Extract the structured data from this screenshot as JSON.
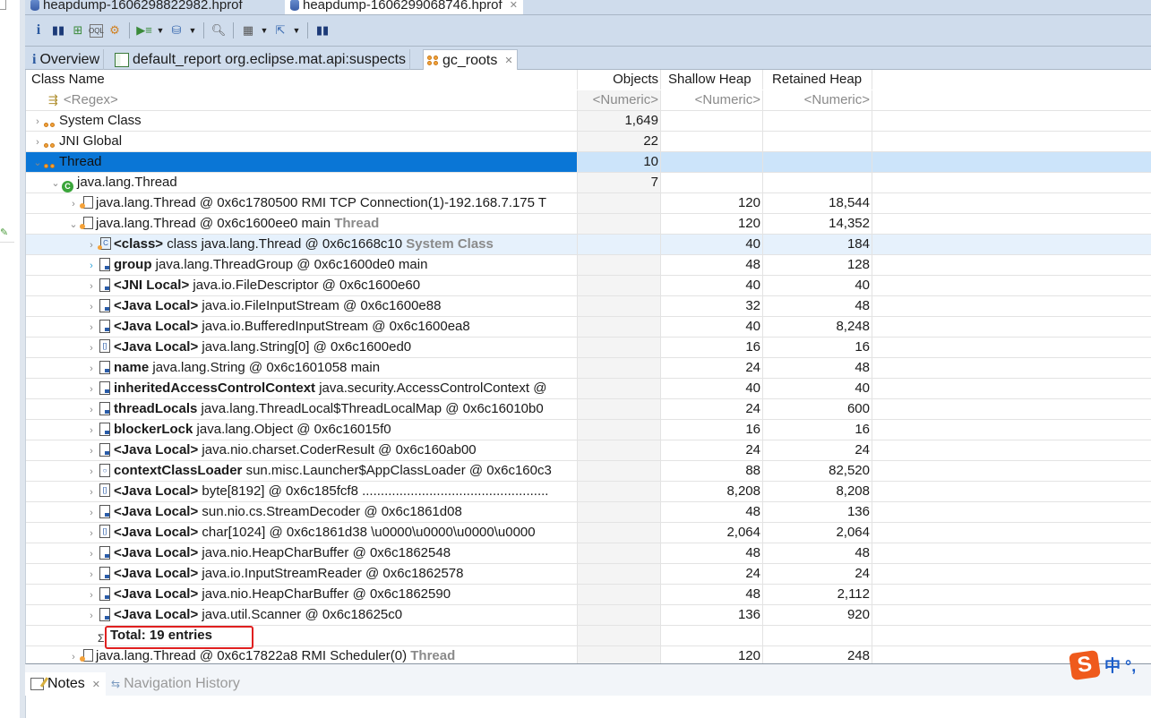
{
  "file_tabs": [
    {
      "label": "heapdump-1606298822982.hprof",
      "active": false
    },
    {
      "label": "heapdump-1606299068746.hprof",
      "active": true
    }
  ],
  "toolbar": {
    "icons": [
      "info-icon",
      "histogram-icon",
      "dominator-tree-icon",
      "oql-icon",
      "thread-overview-icon",
      "run-report-icon",
      "query-browser-icon",
      "find-object-icon",
      "calculate-heap-icon",
      "export-icon",
      "heap-dump-overview-icon"
    ]
  },
  "report_tabs": [
    {
      "label": "Overview",
      "icon": "info-icon"
    },
    {
      "label": "default_report  org.eclipse.mat.api:suspects",
      "icon": "report-icon"
    },
    {
      "label": "gc_roots",
      "icon": "gc-roots-icon",
      "active": true
    }
  ],
  "table": {
    "columns": {
      "name": "Class Name",
      "objects": "Objects",
      "shallow": "Shallow Heap",
      "retained": "Retained Heap"
    },
    "filters": {
      "name": "<Regex>",
      "objects": "<Numeric>",
      "shallow": "<Numeric>",
      "retained": "<Numeric>"
    },
    "rows": [
      {
        "prefix": "",
        "name": "System Class",
        "hint": "",
        "objects": "1,649",
        "shallow": "",
        "retained": ""
      },
      {
        "prefix": "",
        "name": "JNI Global",
        "hint": "",
        "objects": "22",
        "shallow": "",
        "retained": ""
      },
      {
        "prefix": "",
        "name": "Thread",
        "hint": "",
        "objects": "10",
        "shallow": "",
        "retained": ""
      },
      {
        "prefix": "",
        "name": "java.lang.Thread",
        "hint": "",
        "objects": "7",
        "shallow": "",
        "retained": ""
      },
      {
        "prefix": "",
        "name": "java.lang.Thread @ 0x6c1780500  RMI TCP Connection(1)-192.168.7.175 T",
        "hint": "",
        "objects": "",
        "shallow": "120",
        "retained": "18,544"
      },
      {
        "prefix": "",
        "name": "java.lang.Thread @ 0x6c1600ee0  main",
        "hint": "Thread",
        "objects": "",
        "shallow": "120",
        "retained": "14,352"
      },
      {
        "prefix": "<class>",
        "name": "class java.lang.Thread @ 0x6c1668c10",
        "hint": "System Class",
        "objects": "",
        "shallow": "40",
        "retained": "184"
      },
      {
        "prefix": "group",
        "name": "java.lang.ThreadGroup @ 0x6c1600de0  main",
        "hint": "",
        "objects": "",
        "shallow": "48",
        "retained": "128"
      },
      {
        "prefix": "<JNI Local>",
        "name": "java.io.FileDescriptor @ 0x6c1600e60",
        "hint": "",
        "objects": "",
        "shallow": "40",
        "retained": "40"
      },
      {
        "prefix": "<Java Local>",
        "name": "java.io.FileInputStream @ 0x6c1600e88",
        "hint": "",
        "objects": "",
        "shallow": "32",
        "retained": "48"
      },
      {
        "prefix": "<Java Local>",
        "name": "java.io.BufferedInputStream @ 0x6c1600ea8",
        "hint": "",
        "objects": "",
        "shallow": "40",
        "retained": "8,248"
      },
      {
        "prefix": "<Java Local>",
        "name": "java.lang.String[0] @ 0x6c1600ed0",
        "hint": "",
        "objects": "",
        "shallow": "16",
        "retained": "16"
      },
      {
        "prefix": "name",
        "name": "java.lang.String @ 0x6c1601058  main",
        "hint": "",
        "objects": "",
        "shallow": "24",
        "retained": "48"
      },
      {
        "prefix": "inheritedAccessControlContext",
        "name": "java.security.AccessControlContext @",
        "hint": "",
        "objects": "",
        "shallow": "40",
        "retained": "40"
      },
      {
        "prefix": "threadLocals",
        "name": "java.lang.ThreadLocal$ThreadLocalMap @ 0x6c16010b0",
        "hint": "",
        "objects": "",
        "shallow": "24",
        "retained": "600"
      },
      {
        "prefix": "blockerLock",
        "name": "java.lang.Object @ 0x6c16015f0",
        "hint": "",
        "objects": "",
        "shallow": "16",
        "retained": "16"
      },
      {
        "prefix": "<Java Local>",
        "name": "java.nio.charset.CoderResult @ 0x6c160ab00",
        "hint": "",
        "objects": "",
        "shallow": "24",
        "retained": "24"
      },
      {
        "prefix": "contextClassLoader",
        "name": "sun.misc.Launcher$AppClassLoader @ 0x6c160c3",
        "hint": "",
        "objects": "",
        "shallow": "88",
        "retained": "82,520"
      },
      {
        "prefix": "<Java Local>",
        "name": "byte[8192] @ 0x6c185fcf8  ..................................................",
        "hint": "",
        "objects": "",
        "shallow": "8,208",
        "retained": "8,208"
      },
      {
        "prefix": "<Java Local>",
        "name": "sun.nio.cs.StreamDecoder @ 0x6c1861d08",
        "hint": "",
        "objects": "",
        "shallow": "48",
        "retained": "136"
      },
      {
        "prefix": "<Java Local>",
        "name": "char[1024] @ 0x6c1861d38  \\u0000\\u0000\\u0000\\u0000",
        "hint": "",
        "objects": "",
        "shallow": "2,064",
        "retained": "2,064"
      },
      {
        "prefix": "<Java Local>",
        "name": "java.nio.HeapCharBuffer @ 0x6c1862548",
        "hint": "",
        "objects": "",
        "shallow": "48",
        "retained": "48"
      },
      {
        "prefix": "<Java Local>",
        "name": "java.io.InputStreamReader @ 0x6c1862578",
        "hint": "",
        "objects": "",
        "shallow": "24",
        "retained": "24"
      },
      {
        "prefix": "<Java Local>",
        "name": "java.nio.HeapCharBuffer @ 0x6c1862590",
        "hint": "",
        "objects": "",
        "shallow": "48",
        "retained": "2,112"
      },
      {
        "prefix": "<Java Local>",
        "name": "java.util.Scanner @ 0x6c18625c0",
        "hint": "",
        "objects": "",
        "shallow": "136",
        "retained": "920"
      },
      {
        "prefix": "",
        "name": "Total: 19 entries",
        "hint": "",
        "objects": "",
        "shallow": "",
        "retained": ""
      },
      {
        "prefix": "",
        "name": "java.lang.Thread @ 0x6c17822a8  RMI Scheduler(0)",
        "hint": "Thread",
        "objects": "",
        "shallow": "120",
        "retained": "248"
      }
    ]
  },
  "bottom": {
    "tabs": [
      {
        "label": "Notes",
        "active": true
      },
      {
        "label": "Navigation History",
        "active": false
      }
    ]
  },
  "ime": {
    "logo": "S",
    "text": "中 °,"
  }
}
